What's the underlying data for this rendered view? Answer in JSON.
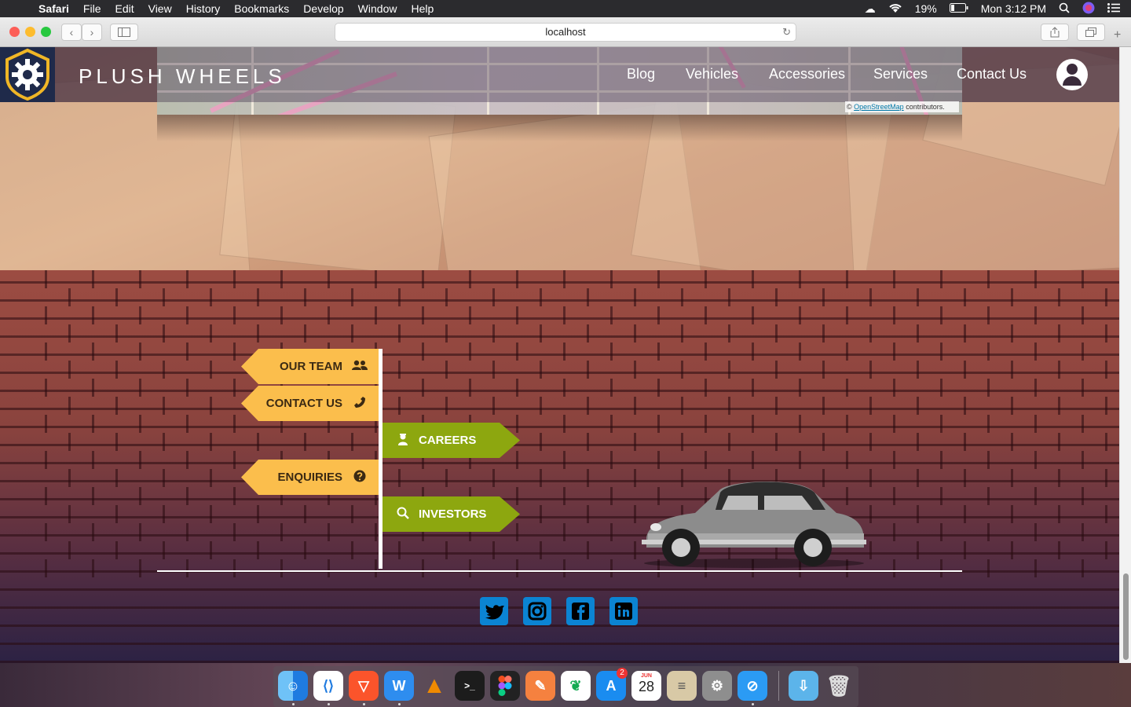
{
  "menubar": {
    "app": "Safari",
    "items": [
      "File",
      "Edit",
      "View",
      "History",
      "Bookmarks",
      "Develop",
      "Window",
      "Help"
    ],
    "battery": "19%",
    "clock": "Mon 3:12 PM"
  },
  "browser": {
    "url": "localhost"
  },
  "site": {
    "brand": "PLUSH WHEELS",
    "nav": [
      "Blog",
      "Vehicles",
      "Accessories",
      "Services",
      "Contact Us"
    ],
    "map_attribution_prefix": "©",
    "map_attribution_link": "OpenStreetMap",
    "map_attribution_suffix": "contributors."
  },
  "signpost": {
    "our_team": "OUR TEAM",
    "contact_us": "CONTACT US",
    "careers": "CAREERS",
    "enquiries": "ENQUIRIES",
    "investors": "INVESTORS"
  },
  "social": [
    "twitter",
    "instagram",
    "facebook",
    "linkedin"
  ],
  "dock": {
    "apps": [
      "Finder",
      "Visual Studio Code",
      "Brave",
      "WebStorm",
      "VLC",
      "Terminal",
      "Figma",
      "Sketch",
      "MongoDB Compass",
      "App Store",
      "Calendar",
      "Notes",
      "System Preferences",
      "Safari",
      "Downloads",
      "Trash"
    ],
    "app_store_badge": "2",
    "calendar_month": "JUN",
    "calendar_day": "28"
  },
  "colors": {
    "sign_yellow": "#fbbe4c",
    "sign_green": "#8da70f",
    "social_blue": "#0b84d3"
  }
}
